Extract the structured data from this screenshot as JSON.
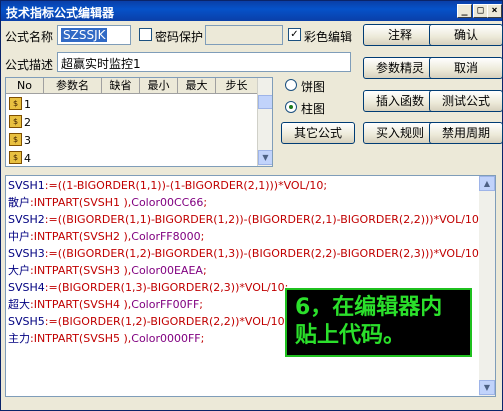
{
  "window": {
    "title": "技术指标公式编辑器"
  },
  "form": {
    "name_label": "公式名称",
    "name_value": "SZSSJK",
    "password_label": "密码保护",
    "color_edit_label": "彩色编辑",
    "desc_label": "公式描述",
    "desc_value": "超赢实时监控1",
    "color_edit_checked": "✓"
  },
  "params_table": {
    "headers": [
      "No",
      "参数名",
      "缺省",
      "最小",
      "最大",
      "步长"
    ],
    "rows": [
      "1",
      "2",
      "3",
      "4"
    ]
  },
  "chart_type": {
    "option1": "饼图",
    "option2": "柱图",
    "selected": "柱图"
  },
  "buttons": {
    "annotate": "注释",
    "ok": "确认",
    "param_tune": "参数精灵",
    "cancel": "取消",
    "insert_func": "插入函数",
    "test_formula": "测试公式",
    "other_formula": "其它公式",
    "buy_rule": "买入规则",
    "ban_period": "禁用周期"
  },
  "code": {
    "lines": [
      [
        [
          "SVSH1",
          "c-k"
        ],
        [
          ":=((1-BIGORDER(1,1))-(1-BIGORDER(2,1)))*VOL/10;",
          "c-o"
        ]
      ],
      [
        [
          "散户",
          "c-k"
        ],
        [
          ":INTPART(SVSH1 ),",
          "c-o"
        ],
        [
          "Color00CC66",
          "c-x"
        ],
        [
          ";",
          "c-o"
        ]
      ],
      [
        [
          "SVSH2",
          "c-k"
        ],
        [
          ":=((BIGORDER(1,1)-BIGORDER(1,2))-(BIGORDER(2,1)-BIGORDER(2,2)))*VOL/10;",
          "c-o"
        ]
      ],
      [
        [
          "中户",
          "c-k"
        ],
        [
          ":INTPART(SVSH2 ),",
          "c-o"
        ],
        [
          "ColorFF8000",
          "c-x"
        ],
        [
          ";",
          "c-o"
        ]
      ],
      [
        [
          "SVSH3",
          "c-k"
        ],
        [
          ":=((BIGORDER(1,2)-BIGORDER(1,3))-(BIGORDER(2,2)-BIGORDER(2,3)))*VOL/10;",
          "c-o"
        ]
      ],
      [
        [
          "大户",
          "c-k"
        ],
        [
          ":INTPART(SVSH3 ),",
          "c-o"
        ],
        [
          "Color00EAEA",
          "c-x"
        ],
        [
          ";",
          "c-o"
        ]
      ],
      [
        [
          "SVSH4",
          "c-k"
        ],
        [
          ":=(BIGORDER(1,3)-BIGORDER(2,3))*VOL/10;",
          "c-o"
        ]
      ],
      [
        [
          "超大",
          "c-k"
        ],
        [
          ":INTPART(SVSH4 ),",
          "c-o"
        ],
        [
          "ColorFF00FF",
          "c-x"
        ],
        [
          ";",
          "c-o"
        ]
      ],
      [
        [
          "SVSH5",
          "c-k"
        ],
        [
          ":=(BIGORDER(1,2)-BIGORDER(2,2))*VOL/10;",
          "c-o"
        ]
      ],
      [
        [
          "主力",
          "c-k"
        ],
        [
          ":INTPART(SVSH5 ),",
          "c-o"
        ],
        [
          "Color0000FF",
          "c-x"
        ],
        [
          ";",
          "c-o"
        ]
      ]
    ]
  },
  "overlay": {
    "line1": "6，在编辑器内",
    "line2": "贴上代码。"
  }
}
